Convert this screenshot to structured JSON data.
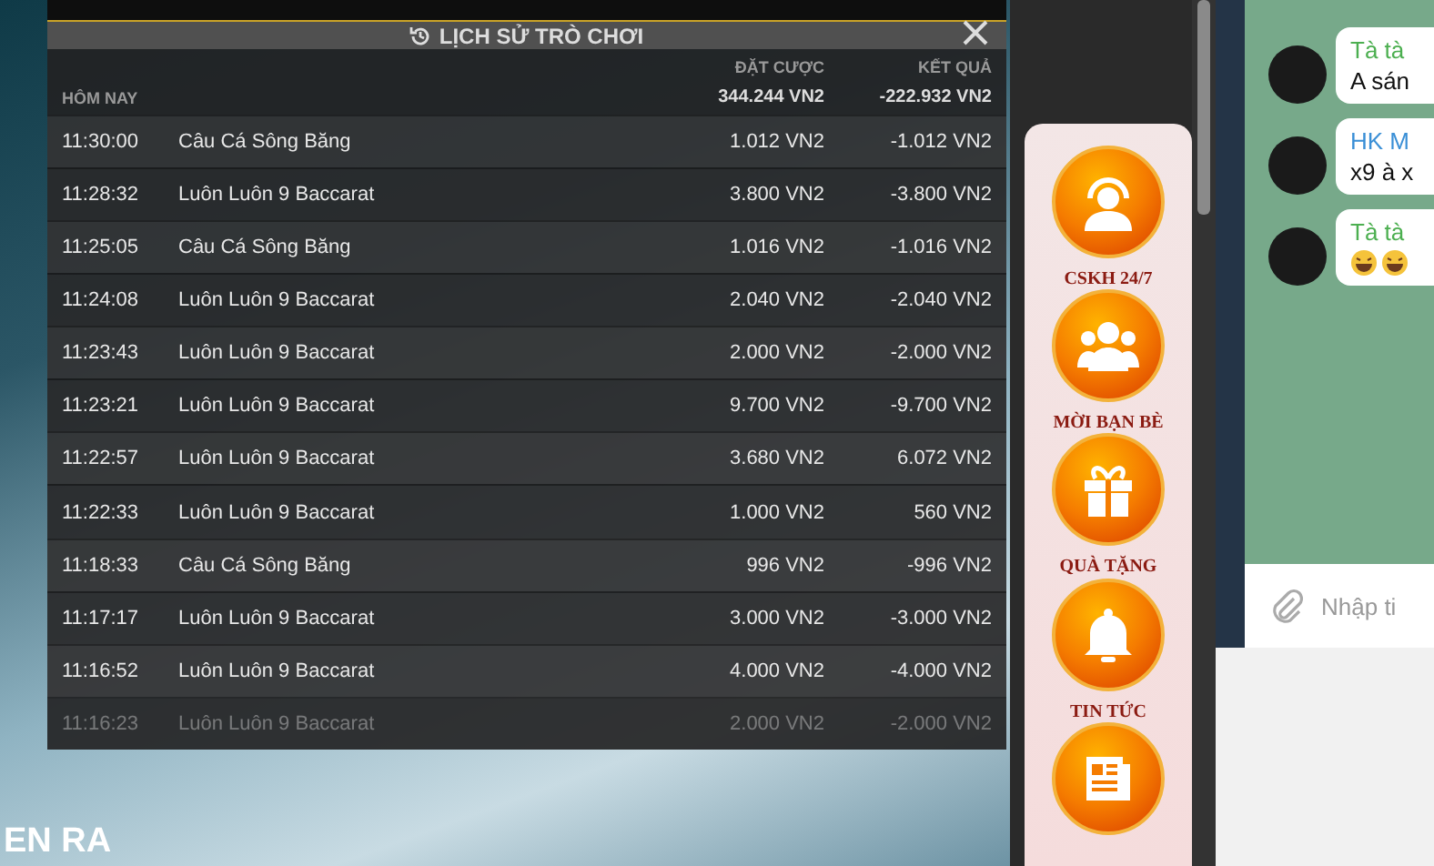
{
  "history": {
    "title": "LỊCH SỬ TRÒ CHƠI",
    "columns": {
      "bet": "ĐẶT CƯỢC",
      "result": "KẾT QUẢ"
    },
    "summary": {
      "label": "HÔM NAY",
      "bet": "344.244 VN2",
      "result": "-222.932 VN2"
    },
    "rows": [
      {
        "time": "11:30:00",
        "game": "Câu Cá Sông Băng",
        "bet": "1.012 VN2",
        "result": "-1.012 VN2",
        "faded": false
      },
      {
        "time": "11:28:32",
        "game": "Luôn Luôn 9 Baccarat",
        "bet": "3.800 VN2",
        "result": "-3.800 VN2",
        "faded": false
      },
      {
        "time": "11:25:05",
        "game": "Câu Cá Sông Băng",
        "bet": "1.016 VN2",
        "result": "-1.016 VN2",
        "faded": false
      },
      {
        "time": "11:24:08",
        "game": "Luôn Luôn 9 Baccarat",
        "bet": "2.040 VN2",
        "result": "-2.040 VN2",
        "faded": false
      },
      {
        "time": "11:23:43",
        "game": "Luôn Luôn 9 Baccarat",
        "bet": "2.000 VN2",
        "result": "-2.000 VN2",
        "faded": false
      },
      {
        "time": "11:23:21",
        "game": "Luôn Luôn 9 Baccarat",
        "bet": "9.700 VN2",
        "result": "-9.700 VN2",
        "faded": false
      },
      {
        "time": "11:22:57",
        "game": "Luôn Luôn 9 Baccarat",
        "bet": "3.680 VN2",
        "result": "6.072 VN2",
        "faded": false
      },
      {
        "time": "11:22:33",
        "game": "Luôn Luôn 9 Baccarat",
        "bet": "1.000 VN2",
        "result": "560 VN2",
        "faded": false
      },
      {
        "time": "11:18:33",
        "game": "Câu Cá Sông Băng",
        "bet": "996 VN2",
        "result": "-996 VN2",
        "faded": false
      },
      {
        "time": "11:17:17",
        "game": "Luôn Luôn 9 Baccarat",
        "bet": "3.000 VN2",
        "result": "-3.000 VN2",
        "faded": false
      },
      {
        "time": "11:16:52",
        "game": "Luôn Luôn 9 Baccarat",
        "bet": "4.000 VN2",
        "result": "-4.000 VN2",
        "faded": false
      },
      {
        "time": "11:16:23",
        "game": "Luôn Luôn 9 Baccarat",
        "bet": "2.000 VN2",
        "result": "-2.000 VN2",
        "faded": true
      }
    ]
  },
  "game_caption": "EN RA",
  "menu": [
    {
      "kind": "support",
      "label": "CSKH 24/7"
    },
    {
      "kind": "friends",
      "label": "MỜI BẠN BÈ"
    },
    {
      "kind": "gift",
      "label": "QUÀ TẶNG"
    },
    {
      "kind": "news",
      "label": "TIN TỨC"
    },
    {
      "kind": "article"
    }
  ],
  "chat": {
    "messages": [
      {
        "kind": "text",
        "author": "Tà tà",
        "color": "#4caf50",
        "text": "A sán"
      },
      {
        "kind": "text",
        "author": "HK M",
        "color": "#3a8fd6",
        "text": "x9 à x"
      },
      {
        "kind": "emoji",
        "author": "Tà tà",
        "color": "#4caf50"
      }
    ],
    "input": {
      "placeholder": "Nhập ti"
    }
  }
}
